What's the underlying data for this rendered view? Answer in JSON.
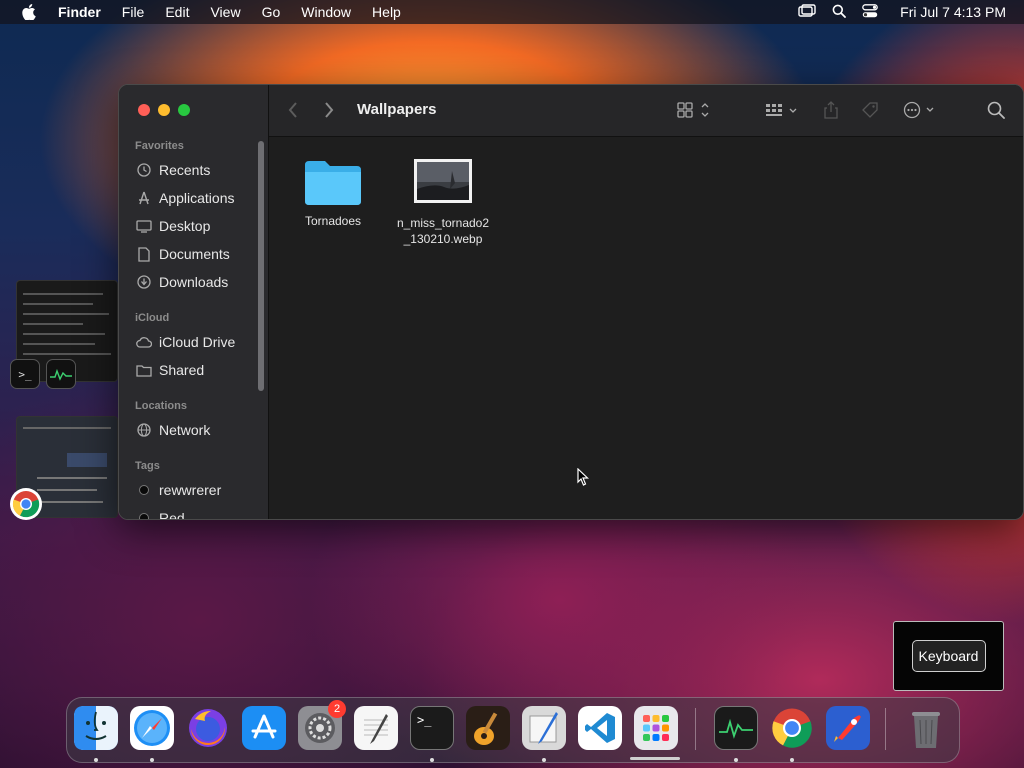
{
  "menubar": {
    "app_name": "Finder",
    "items": [
      "File",
      "Edit",
      "View",
      "Go",
      "Window",
      "Help"
    ],
    "clock": "Fri Jul 7  4:13 PM",
    "icons": [
      "display-icon",
      "spotlight-search-icon",
      "control-center-icon"
    ]
  },
  "finder": {
    "title": "Wallpapers",
    "sidebar": {
      "sections": {
        "favorites": "Favorites",
        "icloud": "iCloud",
        "locations": "Locations",
        "tags": "Tags"
      },
      "favorites": [
        {
          "label": "Recents",
          "icon": "clock-icon"
        },
        {
          "label": "Applications",
          "icon": "applications-icon"
        },
        {
          "label": "Desktop",
          "icon": "desktop-icon"
        },
        {
          "label": "Documents",
          "icon": "document-icon"
        },
        {
          "label": "Downloads",
          "icon": "download-icon"
        }
      ],
      "icloud": [
        {
          "label": "iCloud Drive",
          "icon": "cloud-icon"
        },
        {
          "label": "Shared",
          "icon": "shared-folder-icon"
        }
      ],
      "locations": [
        {
          "label": "Network",
          "icon": "globe-icon"
        }
      ],
      "tags": [
        {
          "label": "rewwrerer",
          "color": "#000000"
        },
        {
          "label": "Red",
          "color": "#000000"
        }
      ]
    },
    "toolbar_icons": [
      "back-icon",
      "forward-icon",
      "icon-view-icon",
      "group-icon",
      "share-icon",
      "tag-icon",
      "more-actions-icon",
      "search-icon"
    ],
    "files": [
      {
        "name": "Tornadoes",
        "kind": "folder"
      },
      {
        "name_line1": "n_miss_tornado2",
        "name_line2": "_130210.webp",
        "kind": "image"
      }
    ]
  },
  "keyboard_popup": {
    "label": "Keyboard"
  },
  "dock": {
    "apps": [
      {
        "name": "Finder",
        "running": true
      },
      {
        "name": "Safari",
        "running": true
      },
      {
        "name": "Firefox",
        "running": false
      },
      {
        "name": "App Store",
        "running": false
      },
      {
        "name": "System Settings",
        "running": false,
        "badge": "2"
      },
      {
        "name": "TextEdit",
        "running": false
      },
      {
        "name": "Terminal",
        "running": true
      },
      {
        "name": "GarageBand",
        "running": false
      },
      {
        "name": "Script Editor",
        "running": true
      },
      {
        "name": "Visual Studio Code",
        "running": false
      },
      {
        "name": "Launchpad",
        "running": false
      },
      {
        "name": "Activity Monitor",
        "running": true
      },
      {
        "name": "Google Chrome",
        "running": true
      },
      {
        "name": "Rocket Typist",
        "running": false
      },
      {
        "name": "Trash",
        "running": false
      }
    ]
  },
  "colors": {
    "folder_blue": "#5ac8fa",
    "close": "#ff5f57",
    "minimize": "#febc2e",
    "zoom": "#28c840",
    "badge": "#ff3b30"
  }
}
